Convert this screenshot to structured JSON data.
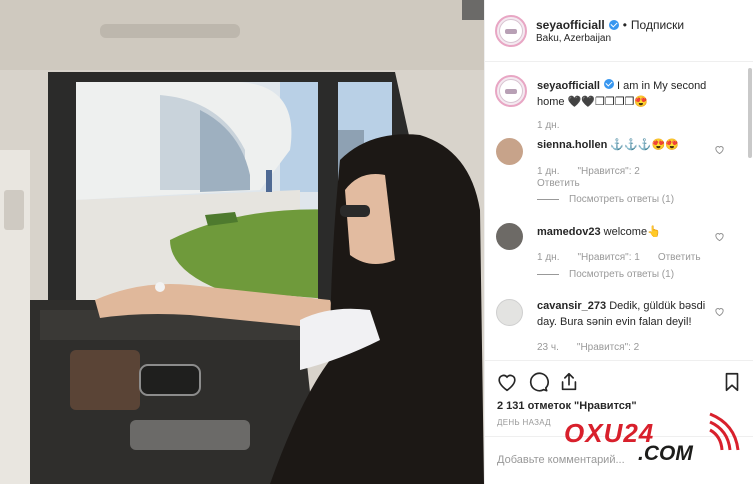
{
  "post": {
    "username": "seyaofficiall",
    "follow_label": "Подписки",
    "location": "Baku, Azerbaijan"
  },
  "caption": {
    "username": "seyaofficiall",
    "text": "I am in My second home 🖤🖤❒❒❒❒😍",
    "time": "1 дн."
  },
  "comments": [
    {
      "username": "sienna.hollen",
      "text": "⚓⚓⚓😍😍",
      "time": "1 дн.",
      "likes": "\"Нравится\": 2",
      "reply_label": "Ответить",
      "view_replies": "Посмотреть ответы (1)"
    },
    {
      "username": "mamedov23",
      "text": "welcome👆",
      "time": "1 дн.",
      "likes": "\"Нравится\": 1",
      "reply_label": "Ответить",
      "view_replies": "Посмотреть ответы (1)"
    },
    {
      "username": "cavansir_273",
      "text": "Dedik, güldük bəsdi day. Bura sənin evin falan deyil!",
      "time": "23 ч.",
      "likes": "\"Нравится\": 2"
    }
  ],
  "actions": {
    "like_icon": "heart-icon",
    "comment_icon": "comment-icon",
    "share_icon": "share-icon",
    "save_icon": "bookmark-icon",
    "likes_count": "2 131 отметок \"Нравится\"",
    "time_ago": "ДЕНЬ НАЗАД"
  },
  "add_comment": {
    "placeholder": "Добавьте комментарий..."
  },
  "watermark": {
    "line1": "OXU24",
    "line2": ".COM"
  },
  "colors": {
    "verified": "#3897f0",
    "watermark_red": "#d8202c",
    "muted_text": "#999999"
  }
}
